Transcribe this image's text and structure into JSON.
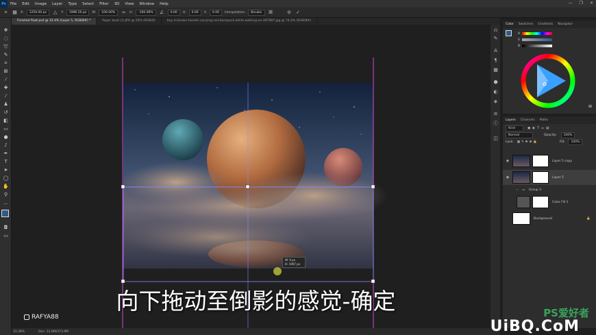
{
  "app": {
    "logo": "Ps"
  },
  "menu": [
    "File",
    "Edit",
    "Image",
    "Layer",
    "Type",
    "Select",
    "Filter",
    "3D",
    "View",
    "Window",
    "Help"
  ],
  "options": {
    "x_label": "X:",
    "x_value": "1250.00 px",
    "y_label": "Y:",
    "y_value": "1996.50 px",
    "w_label": "W:",
    "w_value": "100.00%",
    "h_label": "H:",
    "h_value": "-100.00%",
    "angle_value": "0.00",
    "hskew_label": "H:",
    "hskew_value": "0.00",
    "vskew_label": "V:",
    "vskew_value": "0.00",
    "interp_label": "Interpolation:",
    "interp_value": "Bicubic"
  },
  "tabs": [
    "Finished float.psd @ 33.4% (Layer 5, RGB/8#) *",
    "Paper boat (1).JPG @ 50% (RGB/8)",
    "boy-in-brown-hoodie-carrying-red-backpack-white-walking-on-287887.jpg @ 74.4% (RGB/8#)"
  ],
  "transform_tooltip": {
    "line1_label": "W:",
    "line1_value": "0 px",
    "line2_label": "H:",
    "line2_value": "1967 px"
  },
  "subtitle": "向下拖动至倒影的感觉-确定",
  "watermark_handle": "RAFYA88",
  "watermark_brand": "UiBQ.CoM",
  "watermark_brand_sub": "PS爱好者",
  "color_panel": {
    "tabs": [
      "Color",
      "Swatches",
      "Gradients",
      "Navigator"
    ],
    "h": "H",
    "s": "S",
    "b": "B"
  },
  "layers_panel": {
    "tabs": [
      "Layers",
      "Channels",
      "Paths"
    ],
    "kind": "Kind",
    "blend": "Normal",
    "opacity_label": "Opacity:",
    "opacity_value": "100%",
    "lock_label": "Lock:",
    "fill_label": "Fill:",
    "fill_value": "100%",
    "layers": [
      {
        "name": "Layer 5 copy",
        "selected": false
      },
      {
        "name": "Layer 5",
        "selected": true
      },
      {
        "name": "Group 3",
        "selected": false
      },
      {
        "name": "Color Fill 1",
        "selected": false
      },
      {
        "name": "Background",
        "selected": false
      }
    ]
  },
  "status": {
    "zoom": "33.38%",
    "doc": "Doc: 13.8M/373.9M"
  },
  "colors": {
    "accent": "#31a8ff",
    "guide": "#d64ad6",
    "transform": "#8a8aff"
  }
}
